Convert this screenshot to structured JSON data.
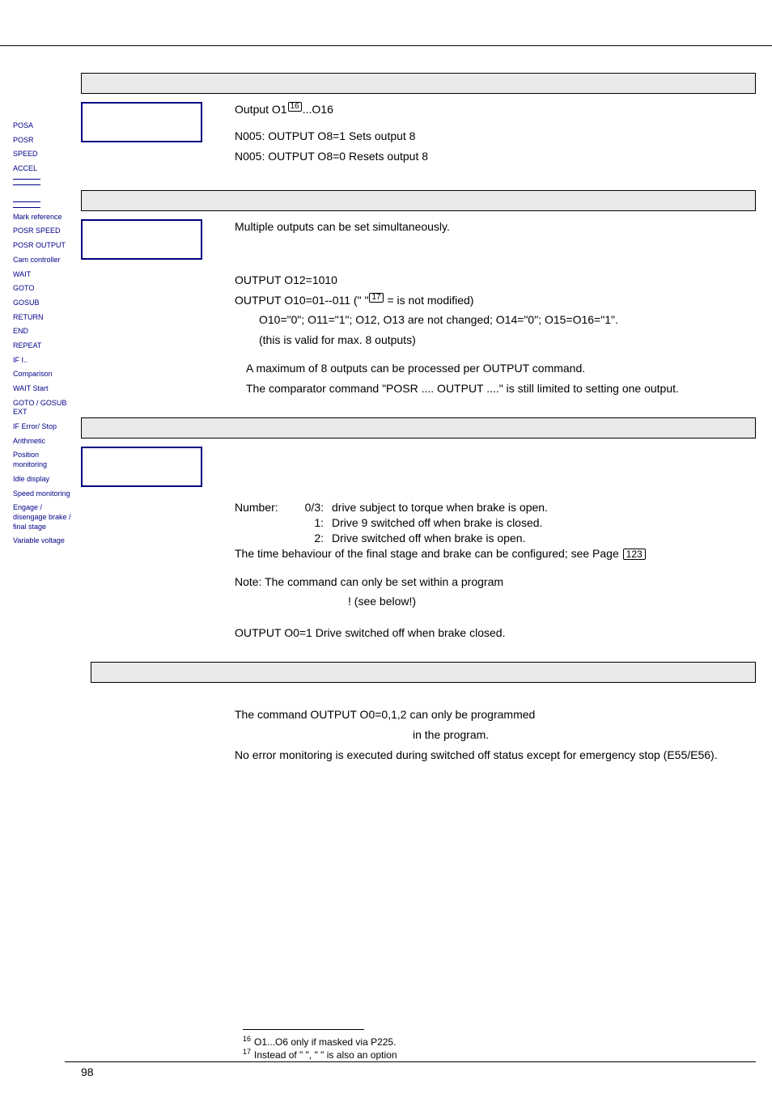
{
  "sidebar": {
    "items": [
      "POSA",
      "POSR",
      "SPEED",
      "ACCEL",
      "",
      "",
      "",
      "",
      "Mark reference",
      "POSR SPEED",
      "POSR OUTPUT",
      "Cam controller",
      "WAIT",
      "GOTO",
      "GOSUB",
      "RETURN",
      "END",
      "REPEAT",
      "IF I..",
      "Comparison",
      "WAIT Start",
      "GOTO / GOSUB EXT",
      "IF Error/ Stop",
      "Arithmetic",
      "Position monitoring",
      "Idle display",
      "Speed monitoring",
      "Engage / disengage brake / final stage",
      "Variable voltage"
    ]
  },
  "section1": {
    "output_line": "Output O1",
    "fn_ref_1": "16",
    "output_line_tail": "...O16",
    "lines": [
      "N005: OUTPUT O8=1  Sets output 8",
      "N005: OUTPUT O8=0  Resets output 8"
    ]
  },
  "section2": {
    "intro": "Multiple outputs can be set simultaneously.",
    "line1": "OUTPUT O12=1010",
    "line2_a": "OUTPUT O10=01--011 (\" \"",
    "fn_ref_2": "17",
    "line2_b": " = is not modified)",
    "line3": "O10=\"0\"; O11=\"1\"; O12, O13 are not changed; O14=\"0\"; O15=O16=\"1\".",
    "line4": "(this is valid for max. 8 outputs)",
    "note1": "A maximum of 8 outputs can be processed per OUTPUT command.",
    "note2": "The comparator command \"POSR .... OUTPUT ....\" is still limited to setting one output."
  },
  "section3": {
    "num_label": "Number:",
    "rows": [
      {
        "n": "0/3:",
        "t": "drive subject to torque when brake is open."
      },
      {
        "n": "1:",
        "t": "Drive 9 switched off when brake is closed."
      },
      {
        "n": "2:",
        "t": "Drive switched off when brake is open."
      }
    ],
    "timeline_a": "The time behaviour of the final stage and brake can be configured; see Page ",
    "page_ref": "123",
    "note_a": "Note: The command can only be set within a program",
    "note_b": "! (see below!)",
    "ex": "OUTPUT O0=1 Drive switched off when brake closed."
  },
  "section4": {
    "l1": "The command OUTPUT O0=0,1,2 can only be programmed",
    "l2": "in the program.",
    "l3": "No error monitoring is executed during switched off status except for emergency stop (E55/E56)."
  },
  "footnotes": {
    "f16": "O1...O6 only if masked via P225.",
    "f17": "Instead of \" \", \" \" is also an option"
  },
  "pagenum": "98"
}
